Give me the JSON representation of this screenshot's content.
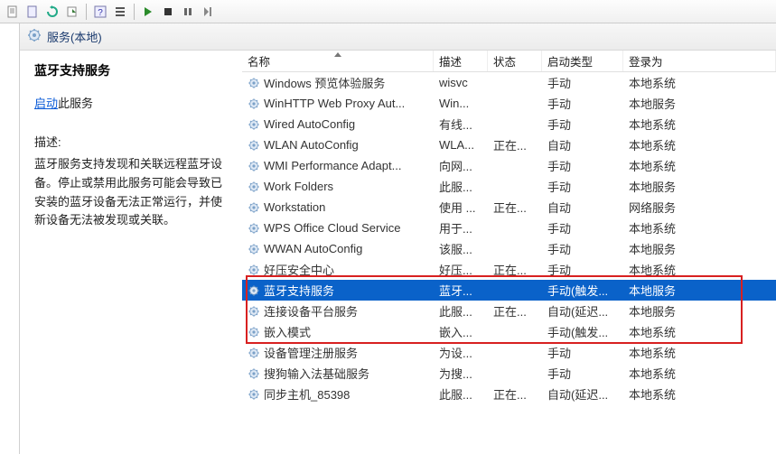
{
  "toolbar": {
    "icons": [
      "doc",
      "page",
      "refresh-green",
      "export",
      "help",
      "list",
      "play",
      "stop",
      "pause",
      "next"
    ]
  },
  "header": {
    "title": "服务(本地)"
  },
  "left": {
    "title": "蓝牙支持服务",
    "start_link": "启动",
    "start_suffix": "此服务",
    "desc_label": "描述:",
    "desc_body": "蓝牙服务支持发现和关联远程蓝牙设备。停止或禁用此服务可能会导致已安装的蓝牙设备无法正常运行，并使新设备无法被发现或关联。"
  },
  "columns": [
    "名称",
    "描述",
    "状态",
    "启动类型",
    "登录为"
  ],
  "services": [
    {
      "name": "Windows 预览体验服务",
      "desc": "wisvc",
      "state": "",
      "startup": "手动",
      "logon": "本地系统"
    },
    {
      "name": "WinHTTP Web Proxy Aut...",
      "desc": "Win...",
      "state": "",
      "startup": "手动",
      "logon": "本地服务"
    },
    {
      "name": "Wired AutoConfig",
      "desc": "有线...",
      "state": "",
      "startup": "手动",
      "logon": "本地系统"
    },
    {
      "name": "WLAN AutoConfig",
      "desc": "WLA...",
      "state": "正在...",
      "startup": "自动",
      "logon": "本地系统"
    },
    {
      "name": "WMI Performance Adapt...",
      "desc": "向网...",
      "state": "",
      "startup": "手动",
      "logon": "本地系统"
    },
    {
      "name": "Work Folders",
      "desc": "此服...",
      "state": "",
      "startup": "手动",
      "logon": "本地服务"
    },
    {
      "name": "Workstation",
      "desc": "使用 ...",
      "state": "正在...",
      "startup": "自动",
      "logon": "网络服务"
    },
    {
      "name": "WPS Office Cloud Service",
      "desc": "用于...",
      "state": "",
      "startup": "手动",
      "logon": "本地系统"
    },
    {
      "name": "WWAN AutoConfig",
      "desc": "该服...",
      "state": "",
      "startup": "手动",
      "logon": "本地服务"
    },
    {
      "name": "好压安全中心",
      "desc": "好压...",
      "state": "正在...",
      "startup": "手动",
      "logon": "本地系统"
    },
    {
      "name": "蓝牙支持服务",
      "desc": "蓝牙...",
      "state": "",
      "startup": "手动(触发...",
      "logon": "本地服务",
      "selected": true
    },
    {
      "name": "连接设备平台服务",
      "desc": "此服...",
      "state": "正在...",
      "startup": "自动(延迟...",
      "logon": "本地服务"
    },
    {
      "name": "嵌入模式",
      "desc": "嵌入...",
      "state": "",
      "startup": "手动(触发...",
      "logon": "本地系统"
    },
    {
      "name": "设备管理注册服务",
      "desc": "为设...",
      "state": "",
      "startup": "手动",
      "logon": "本地系统"
    },
    {
      "name": "搜狗输入法基础服务",
      "desc": "为搜...",
      "state": "",
      "startup": "手动",
      "logon": "本地系统"
    },
    {
      "name": "同步主机_85398",
      "desc": "此服...",
      "state": "正在...",
      "startup": "自动(延迟...",
      "logon": "本地系统"
    }
  ]
}
